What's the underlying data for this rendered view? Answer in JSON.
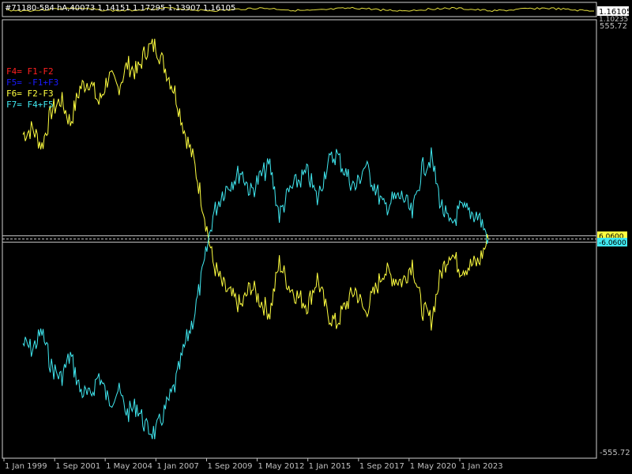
{
  "top_panel": {
    "title": "#71180-584 hA,40073 1.14151 1.17295 1.13907 1.16105",
    "price_label": "1.16105",
    "secondary_label": "1.10235"
  },
  "indicator_legend": [
    {
      "label": "F4=  F1-F2",
      "color": "#ff2020"
    },
    {
      "label": "F5=  -F1+F3",
      "color": "#1a1aff"
    },
    {
      "label": "F6=  F2-F3",
      "color": "#ffff40"
    },
    {
      "label": "F7=  F4+F5",
      "color": "#40e8f0"
    }
  ],
  "price_tags": [
    {
      "label": "6.0600",
      "color": "#ffff40"
    },
    {
      "label": "-6.0600",
      "color": "#40e8f0"
    }
  ],
  "chart_data": {
    "type": "line",
    "ylim": [
      -555.72,
      555.72
    ],
    "y_tick_labels": [
      "555.72",
      "-555.72"
    ],
    "x_tick_labels": [
      "1 Jan 1999",
      "1 Sep 2001",
      "1 May 2004",
      "1 Jan 2007",
      "1 Sep 2009",
      "1 May 2012",
      "1 Jan 2015",
      "1 Sep 2017",
      "1 May 2020",
      "1 Jan 2023"
    ],
    "x_tick_years": [
      1999.0,
      2001.67,
      2004.33,
      2007.0,
      2009.67,
      2012.33,
      2015.0,
      2017.67,
      2020.33,
      2023.0
    ],
    "x": [
      2000.0,
      2000.5,
      2001.0,
      2001.5,
      2002.0,
      2002.5,
      2003.0,
      2003.5,
      2004.0,
      2004.5,
      2005.0,
      2005.5,
      2006.0,
      2006.5,
      2007.0,
      2007.5,
      2008.0,
      2008.5,
      2009.0,
      2009.5,
      2010.0,
      2010.5,
      2011.0,
      2011.5,
      2012.0,
      2012.5,
      2013.0,
      2013.5,
      2014.0,
      2014.5,
      2015.0,
      2015.5,
      2016.0,
      2016.5,
      2017.0,
      2017.5,
      2018.0,
      2018.5,
      2019.0,
      2019.5,
      2020.0,
      2020.5,
      2021.0,
      2021.5,
      2022.0,
      2022.5,
      2023.0,
      2023.5,
      2024.0,
      2024.5
    ],
    "series": [
      {
        "color": "#ffff40",
        "values": [
          270,
          285,
          240,
          330,
          360,
          300,
          390,
          410,
          350,
          420,
          390,
          450,
          430,
          490,
          500,
          440,
          380,
          280,
          200,
          80,
          -60,
          -120,
          -150,
          -175,
          -120,
          -160,
          -190,
          -60,
          -120,
          -150,
          -170,
          -100,
          -190,
          -220,
          -170,
          -130,
          -190,
          -140,
          -80,
          -100,
          -110,
          -60,
          -180,
          -210,
          -90,
          -30,
          -75,
          -70,
          -60,
          0
        ]
      },
      {
        "color": "#40e8f0",
        "values": [
          -270,
          -285,
          -240,
          -330,
          -360,
          -300,
          -390,
          -410,
          -350,
          -420,
          -390,
          -450,
          -430,
          -490,
          -500,
          -440,
          -380,
          -280,
          -200,
          -80,
          60,
          120,
          150,
          175,
          120,
          160,
          190,
          60,
          120,
          150,
          170,
          100,
          190,
          220,
          170,
          130,
          190,
          140,
          80,
          100,
          110,
          60,
          180,
          210,
          90,
          30,
          75,
          70,
          60,
          0
        ]
      }
    ]
  }
}
